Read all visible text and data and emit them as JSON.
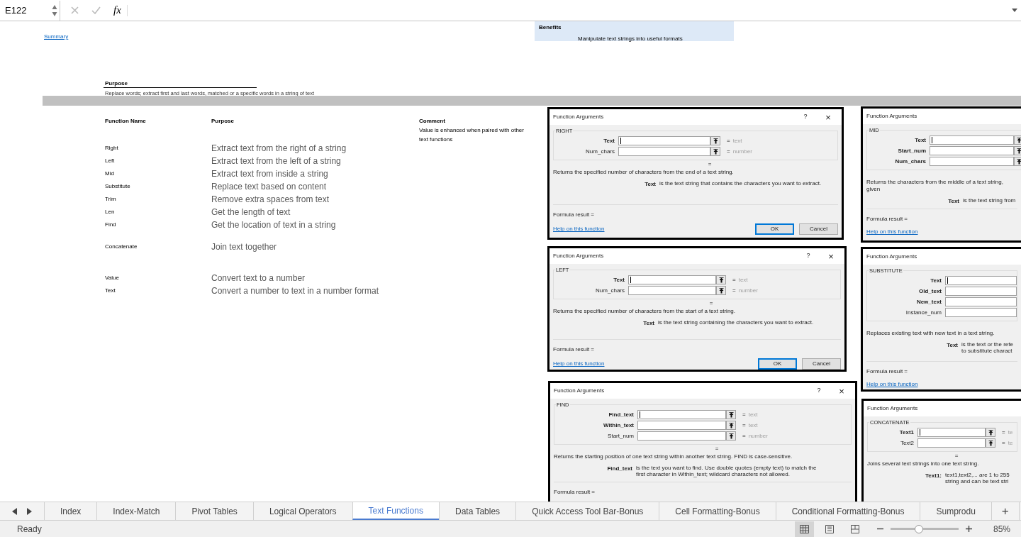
{
  "formula_bar": {
    "name_box": "E122",
    "function_label": "fx"
  },
  "sheet": {
    "summary_link": "Summary",
    "benefits": {
      "title": "Benefits",
      "text": "Manipulate text strings into useful formats"
    },
    "purpose": {
      "title": "Purpose",
      "text": "Replace words; extract first and last words, matched or a specific words in a string of text"
    },
    "columns": [
      "Function Name",
      "Purpose",
      "Comment"
    ],
    "comment": "Value is enhanced when paired with other text functions",
    "groups": [
      [
        {
          "name": "Right",
          "purpose": "Extract text from the right of a string"
        },
        {
          "name": "Left",
          "purpose": "Extract text from the left of a string"
        },
        {
          "name": "Mid",
          "purpose": "Extract text from inside a string"
        },
        {
          "name": "Substitute",
          "purpose": "Replace text based on content"
        },
        {
          "name": "Trim",
          "purpose": "Remove extra spaces from text"
        },
        {
          "name": "Len",
          "purpose": "Get the length of text"
        },
        {
          "name": "Find",
          "purpose": "Get the location of text in a string"
        }
      ],
      [
        {
          "name": "Concatenate",
          "purpose": "Join text together"
        }
      ],
      [
        {
          "name": "Value",
          "purpose": "Convert text to a number"
        },
        {
          "name": "Text",
          "purpose": "Convert a number to text in a number format"
        }
      ]
    ]
  },
  "dialogs": [
    {
      "title": "Function Arguments",
      "help_button": "?",
      "close_button": "×",
      "function": "RIGHT",
      "args": [
        {
          "label": "Text",
          "bold": true,
          "cursor": true,
          "ref_button": true,
          "equals": "=",
          "hint": "text"
        },
        {
          "label": "Num_chars",
          "bold": false,
          "cursor": false,
          "ref_button": true,
          "equals": "=",
          "hint": "number"
        }
      ],
      "result_equals": "=",
      "description": "Returns the specified number of characters from the end of a text string.",
      "arg_help": {
        "name": "Text",
        "lines": [
          "is the text string that contains the characters you want to extract."
        ]
      },
      "formula_result": "Formula result =",
      "help_link": "Help on this function",
      "buttons": [
        {
          "label": "OK",
          "default": true
        },
        {
          "label": "Cancel",
          "default": false
        }
      ]
    },
    {
      "title": "Function Arguments",
      "help_button": "?",
      "close_button": "×",
      "function": "LEFT",
      "args": [
        {
          "label": "Text",
          "bold": true,
          "cursor": true,
          "ref_button": true,
          "equals": "=",
          "hint": "text"
        },
        {
          "label": "Num_chars",
          "bold": false,
          "cursor": false,
          "ref_button": true,
          "equals": "=",
          "hint": "number"
        }
      ],
      "result_equals": "=",
      "description": "Returns the specified number of characters from the start of a text string.",
      "arg_help": {
        "name": "Text",
        "lines": [
          "is the text string containing the characters you want to extract."
        ]
      },
      "formula_result": "Formula result =",
      "help_link": "Help on this function",
      "buttons": [
        {
          "label": "OK",
          "default": true
        },
        {
          "label": "Cancel",
          "default": false
        }
      ]
    },
    {
      "title": "Function Arguments",
      "help_button": "?",
      "close_button": "×",
      "function": "FIND",
      "args": [
        {
          "label": "Find_text",
          "bold": true,
          "cursor": true,
          "ref_button": true,
          "equals": "=",
          "hint": "text"
        },
        {
          "label": "Within_text",
          "bold": true,
          "cursor": false,
          "ref_button": true,
          "equals": "=",
          "hint": "text"
        },
        {
          "label": "Start_num",
          "bold": false,
          "cursor": false,
          "ref_button": true,
          "equals": "=",
          "hint": "number"
        }
      ],
      "result_equals": "=",
      "description": "Returns the starting position of one text string within another text string. FIND is case-sensitive.",
      "arg_help": {
        "name": "Find_text",
        "lines": [
          "is the text you want to find. Use double quotes (empty text) to match the",
          "first character in Within_text; wildcard characters not allowed."
        ]
      },
      "formula_result": "Formula result ="
    },
    {
      "title": "Function Arguments",
      "function": "MID",
      "args": [
        {
          "label": "Text",
          "bold": true,
          "cursor": true,
          "ref_button": true
        },
        {
          "label": "Start_num",
          "bold": true,
          "cursor": false,
          "ref_button": true
        },
        {
          "label": "Num_chars",
          "bold": true,
          "cursor": false,
          "ref_button": true
        }
      ],
      "description": "Returns the characters from the middle of a text string, given",
      "arg_help": {
        "name": "Text",
        "lines": [
          "is the text string from"
        ]
      },
      "formula_result": "Formula result =",
      "help_link": "Help on this function"
    },
    {
      "title": "Function Arguments",
      "function": "SUBSTITUTE",
      "args": [
        {
          "label": "Text",
          "bold": true,
          "cursor": true,
          "ref_button": false
        },
        {
          "label": "Old_text",
          "bold": true,
          "cursor": false,
          "ref_button": false
        },
        {
          "label": "New_text",
          "bold": true,
          "cursor": false,
          "ref_button": false
        },
        {
          "label": "Instance_num",
          "bold": false,
          "cursor": false,
          "ref_button": false
        }
      ],
      "description": "Replaces existing text with new text in a text string.",
      "arg_help": {
        "name": "Text",
        "lines": [
          "is the text or the refe",
          "to substitute charact"
        ]
      },
      "formula_result": "Formula result =",
      "help_link": "Help on this function"
    },
    {
      "title": "Function Arguments",
      "function": "CONCATENATE",
      "args": [
        {
          "label": "Text1",
          "bold": true,
          "cursor": true,
          "ref_button": true,
          "equals": "=",
          "hint": "te"
        },
        {
          "label": "Text2",
          "bold": false,
          "cursor": false,
          "ref_button": true,
          "equals": "=",
          "hint": "te"
        }
      ],
      "result_equals": "=",
      "description": "Joins several text strings into one text string.",
      "arg_help": {
        "name": "Text1:",
        "lines": [
          "text1,text2,... are 1 to 255",
          "string and can be text stri"
        ]
      }
    }
  ],
  "sheet_tabs": [
    {
      "label": "Index",
      "selected": false
    },
    {
      "label": "Index-Match",
      "selected": false
    },
    {
      "label": "Pivot Tables",
      "selected": false
    },
    {
      "label": "Logical Operators",
      "selected": false
    },
    {
      "label": "Text Functions",
      "selected": true
    },
    {
      "label": "Data Tables",
      "selected": false
    },
    {
      "label": "Quick Access Tool Bar-Bonus",
      "selected": false
    },
    {
      "label": "Cell Formatting-Bonus",
      "selected": false
    },
    {
      "label": "Conditional Formatting-Bonus",
      "selected": false
    },
    {
      "label": "Sumprodu",
      "selected": false
    }
  ],
  "add_sheet": "+",
  "status_bar": {
    "status": "Ready",
    "views": [
      {
        "kind": "normal",
        "selected": true
      },
      {
        "kind": "page_layout",
        "selected": false
      },
      {
        "kind": "page_break",
        "selected": false
      }
    ],
    "zoom": {
      "level": 0.42,
      "reading": "85%"
    }
  }
}
